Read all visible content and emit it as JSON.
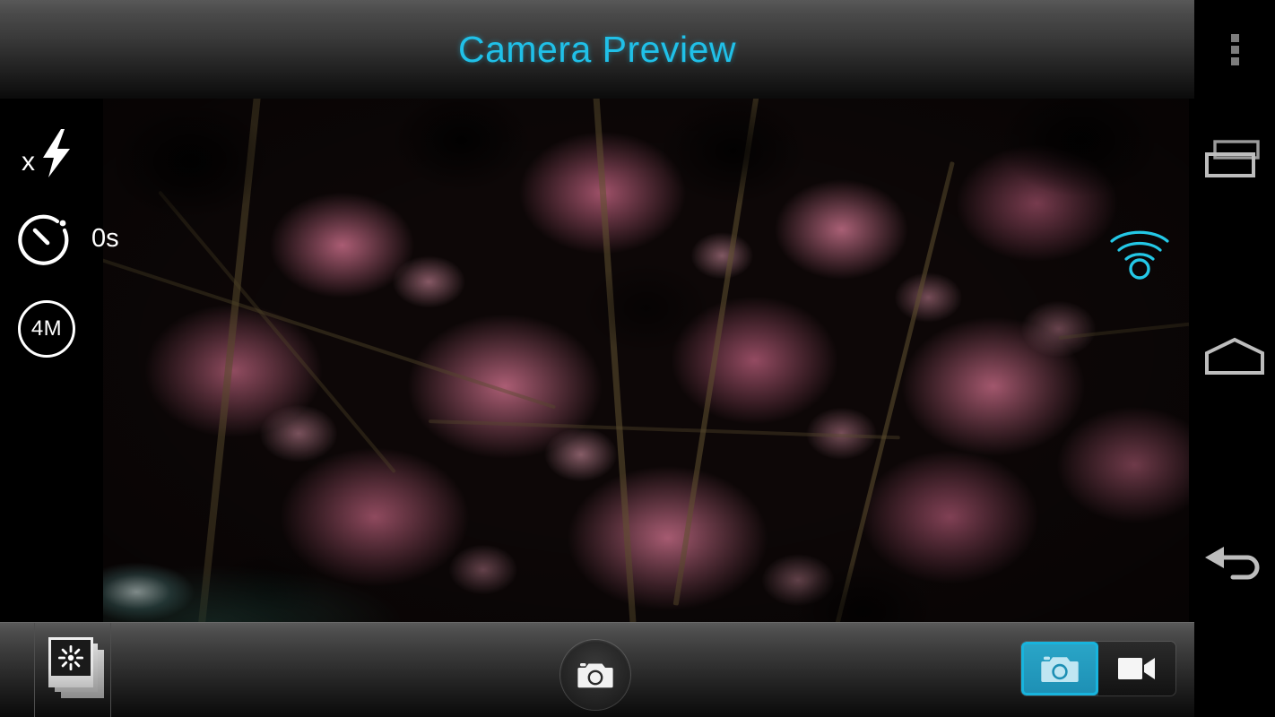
{
  "app": {
    "title": "Camera Preview",
    "title_color": "#20c0e8"
  },
  "overlay_controls": {
    "flash": {
      "icon": "flash-off-icon",
      "state_label": "x"
    },
    "timer": {
      "icon": "timer-icon",
      "value": "0s"
    },
    "resolution": {
      "icon": "resolution-icon",
      "value": "4M"
    },
    "wifi": {
      "icon": "wifi-icon",
      "color": "#20c0e8"
    }
  },
  "preview": {
    "subject": "night cherry blossom tree",
    "dominant_color": "#c4607a"
  },
  "bottom_bar": {
    "gallery": {
      "icon": "gallery-thumbnail-icon",
      "label": "Gallery"
    },
    "shutter": {
      "icon": "camera-shutter-icon",
      "label": "Shutter"
    },
    "mode_toggle": {
      "selected": "camera",
      "options": [
        {
          "id": "camera",
          "icon": "camera-icon",
          "label": "Camera",
          "selected": true
        },
        {
          "id": "video",
          "icon": "video-camera-icon",
          "label": "Video",
          "selected": false
        }
      ],
      "accent_color": "#18b4dd"
    }
  },
  "navigation_bar": {
    "items": [
      {
        "id": "overflow",
        "icon": "overflow-menu-icon",
        "label": "More options"
      },
      {
        "id": "recents",
        "icon": "recents-icon",
        "label": "Recent apps"
      },
      {
        "id": "home",
        "icon": "home-icon",
        "label": "Home"
      },
      {
        "id": "back",
        "icon": "back-icon",
        "label": "Back"
      }
    ]
  }
}
